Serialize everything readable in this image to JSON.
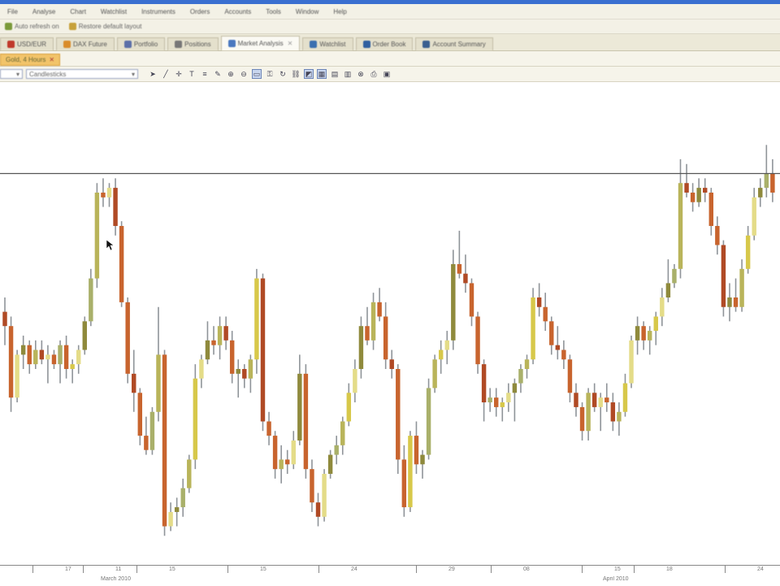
{
  "menu": [
    "File",
    "Analyse",
    "Chart",
    "Watchlist",
    "Instruments",
    "Orders",
    "Accounts",
    "Tools",
    "Window",
    "Help"
  ],
  "toolbar1": [
    {
      "label": "Auto refresh on",
      "icon": "refresh-icon",
      "color": "#7a9a3a"
    },
    {
      "label": "Restore default layout",
      "icon": "layout-icon",
      "color": "#c7a13a"
    }
  ],
  "tabs": [
    {
      "label": "USD/EUR",
      "icon": "chart-icon",
      "color": "#c0392b",
      "active": false
    },
    {
      "label": "DAX Future",
      "icon": "chart-icon",
      "color": "#d98c2b",
      "active": false
    },
    {
      "label": "Portfolio",
      "icon": "portfolio-icon",
      "color": "#5b6fa8",
      "active": false
    },
    {
      "label": "Positions",
      "icon": "positions-icon",
      "color": "#777777",
      "active": false
    },
    {
      "label": "Market Analysis",
      "icon": "analysis-icon",
      "color": "#4a78c0",
      "active": true
    },
    {
      "label": "Watchlist",
      "icon": "watchlist-icon",
      "color": "#3a6fb0",
      "active": false
    },
    {
      "label": "Order Book",
      "icon": "orderbook-icon",
      "color": "#2f5fa0",
      "active": false
    },
    {
      "label": "Account Summary",
      "icon": "account-icon",
      "color": "#3a5f90",
      "active": false
    }
  ],
  "doc_tab": {
    "label": "Gold, 4 Hours"
  },
  "chart_toolbar": {
    "interval_value": "",
    "chart_type_value": "Candlesticks"
  },
  "chart_data": {
    "type": "candlestick",
    "axis_position": "bottom",
    "reference_line": {
      "y": 1090
    },
    "ylim": [
      1012,
      1101
    ],
    "x_ticks": [
      "17",
      "11",
      "15",
      "15",
      "24",
      "29",
      "08",
      "15",
      "18",
      "24"
    ],
    "month_labels": [
      "March 2010",
      "April 2010"
    ],
    "candles": [
      {
        "o": 1061,
        "h": 1064,
        "l": 1054,
        "c": 1058
      },
      {
        "o": 1058,
        "h": 1060,
        "l": 1040,
        "c": 1043
      },
      {
        "o": 1043,
        "h": 1053,
        "l": 1042,
        "c": 1052
      },
      {
        "o": 1052,
        "h": 1056,
        "l": 1049,
        "c": 1054
      },
      {
        "o": 1054,
        "h": 1055,
        "l": 1048,
        "c": 1050
      },
      {
        "o": 1050,
        "h": 1055,
        "l": 1049,
        "c": 1053
      },
      {
        "o": 1053,
        "h": 1055,
        "l": 1050,
        "c": 1051
      },
      {
        "o": 1051,
        "h": 1054,
        "l": 1046,
        "c": 1052
      },
      {
        "o": 1052,
        "h": 1053,
        "l": 1049,
        "c": 1050
      },
      {
        "o": 1050,
        "h": 1055,
        "l": 1046,
        "c": 1054
      },
      {
        "o": 1054,
        "h": 1056,
        "l": 1047,
        "c": 1049
      },
      {
        "o": 1049,
        "h": 1051,
        "l": 1046,
        "c": 1050
      },
      {
        "o": 1050,
        "h": 1054,
        "l": 1048,
        "c": 1053
      },
      {
        "o": 1053,
        "h": 1060,
        "l": 1052,
        "c": 1059
      },
      {
        "o": 1059,
        "h": 1070,
        "l": 1058,
        "c": 1068
      },
      {
        "o": 1068,
        "h": 1088,
        "l": 1066,
        "c": 1086
      },
      {
        "o": 1086,
        "h": 1089,
        "l": 1083,
        "c": 1085
      },
      {
        "o": 1085,
        "h": 1088,
        "l": 1083,
        "c": 1087
      },
      {
        "o": 1087,
        "h": 1089,
        "l": 1077,
        "c": 1079
      },
      {
        "o": 1079,
        "h": 1080,
        "l": 1062,
        "c": 1063
      },
      {
        "o": 1063,
        "h": 1064,
        "l": 1046,
        "c": 1048
      },
      {
        "o": 1048,
        "h": 1053,
        "l": 1040,
        "c": 1044
      },
      {
        "o": 1044,
        "h": 1045,
        "l": 1033,
        "c": 1035
      },
      {
        "o": 1035,
        "h": 1039,
        "l": 1031,
        "c": 1032
      },
      {
        "o": 1032,
        "h": 1041,
        "l": 1031,
        "c": 1040
      },
      {
        "o": 1040,
        "h": 1062,
        "l": 1038,
        "c": 1052
      },
      {
        "o": 1052,
        "h": 1053,
        "l": 1014,
        "c": 1016
      },
      {
        "o": 1016,
        "h": 1021,
        "l": 1015,
        "c": 1019
      },
      {
        "o": 1019,
        "h": 1022,
        "l": 1016,
        "c": 1020
      },
      {
        "o": 1020,
        "h": 1026,
        "l": 1018,
        "c": 1024
      },
      {
        "o": 1024,
        "h": 1031,
        "l": 1023,
        "c": 1030
      },
      {
        "o": 1030,
        "h": 1050,
        "l": 1028,
        "c": 1047
      },
      {
        "o": 1047,
        "h": 1052,
        "l": 1045,
        "c": 1051
      },
      {
        "o": 1051,
        "h": 1059,
        "l": 1050,
        "c": 1055
      },
      {
        "o": 1055,
        "h": 1058,
        "l": 1052,
        "c": 1054
      },
      {
        "o": 1054,
        "h": 1060,
        "l": 1051,
        "c": 1058
      },
      {
        "o": 1058,
        "h": 1060,
        "l": 1053,
        "c": 1055
      },
      {
        "o": 1055,
        "h": 1057,
        "l": 1046,
        "c": 1048
      },
      {
        "o": 1048,
        "h": 1051,
        "l": 1043,
        "c": 1049
      },
      {
        "o": 1049,
        "h": 1050,
        "l": 1045,
        "c": 1047
      },
      {
        "o": 1047,
        "h": 1052,
        "l": 1044,
        "c": 1051
      },
      {
        "o": 1051,
        "h": 1070,
        "l": 1048,
        "c": 1068
      },
      {
        "o": 1068,
        "h": 1069,
        "l": 1036,
        "c": 1038
      },
      {
        "o": 1038,
        "h": 1040,
        "l": 1033,
        "c": 1035
      },
      {
        "o": 1035,
        "h": 1036,
        "l": 1026,
        "c": 1028
      },
      {
        "o": 1028,
        "h": 1033,
        "l": 1025,
        "c": 1030
      },
      {
        "o": 1030,
        "h": 1032,
        "l": 1027,
        "c": 1029
      },
      {
        "o": 1029,
        "h": 1036,
        "l": 1028,
        "c": 1034
      },
      {
        "o": 1034,
        "h": 1052,
        "l": 1033,
        "c": 1048
      },
      {
        "o": 1048,
        "h": 1050,
        "l": 1026,
        "c": 1028
      },
      {
        "o": 1028,
        "h": 1030,
        "l": 1019,
        "c": 1021
      },
      {
        "o": 1021,
        "h": 1023,
        "l": 1016,
        "c": 1018
      },
      {
        "o": 1018,
        "h": 1028,
        "l": 1017,
        "c": 1027
      },
      {
        "o": 1027,
        "h": 1032,
        "l": 1026,
        "c": 1031
      },
      {
        "o": 1031,
        "h": 1035,
        "l": 1029,
        "c": 1033
      },
      {
        "o": 1033,
        "h": 1039,
        "l": 1031,
        "c": 1038
      },
      {
        "o": 1038,
        "h": 1046,
        "l": 1037,
        "c": 1044
      },
      {
        "o": 1044,
        "h": 1051,
        "l": 1042,
        "c": 1049
      },
      {
        "o": 1049,
        "h": 1060,
        "l": 1047,
        "c": 1058
      },
      {
        "o": 1058,
        "h": 1062,
        "l": 1054,
        "c": 1055
      },
      {
        "o": 1055,
        "h": 1065,
        "l": 1053,
        "c": 1063
      },
      {
        "o": 1063,
        "h": 1066,
        "l": 1059,
        "c": 1060
      },
      {
        "o": 1060,
        "h": 1063,
        "l": 1049,
        "c": 1051
      },
      {
        "o": 1051,
        "h": 1053,
        "l": 1047,
        "c": 1049
      },
      {
        "o": 1049,
        "h": 1050,
        "l": 1027,
        "c": 1030
      },
      {
        "o": 1030,
        "h": 1033,
        "l": 1018,
        "c": 1020
      },
      {
        "o": 1020,
        "h": 1036,
        "l": 1019,
        "c": 1035
      },
      {
        "o": 1035,
        "h": 1038,
        "l": 1027,
        "c": 1029
      },
      {
        "o": 1029,
        "h": 1032,
        "l": 1026,
        "c": 1031
      },
      {
        "o": 1031,
        "h": 1047,
        "l": 1030,
        "c": 1045
      },
      {
        "o": 1045,
        "h": 1052,
        "l": 1044,
        "c": 1051
      },
      {
        "o": 1051,
        "h": 1055,
        "l": 1048,
        "c": 1053
      },
      {
        "o": 1053,
        "h": 1057,
        "l": 1050,
        "c": 1055
      },
      {
        "o": 1055,
        "h": 1074,
        "l": 1053,
        "c": 1071
      },
      {
        "o": 1071,
        "h": 1078,
        "l": 1068,
        "c": 1069
      },
      {
        "o": 1069,
        "h": 1073,
        "l": 1065,
        "c": 1067
      },
      {
        "o": 1067,
        "h": 1068,
        "l": 1058,
        "c": 1060
      },
      {
        "o": 1060,
        "h": 1061,
        "l": 1048,
        "c": 1050
      },
      {
        "o": 1050,
        "h": 1051,
        "l": 1038,
        "c": 1042
      },
      {
        "o": 1042,
        "h": 1045,
        "l": 1040,
        "c": 1043
      },
      {
        "o": 1043,
        "h": 1045,
        "l": 1039,
        "c": 1041
      },
      {
        "o": 1041,
        "h": 1043,
        "l": 1038,
        "c": 1042
      },
      {
        "o": 1042,
        "h": 1046,
        "l": 1040,
        "c": 1044
      },
      {
        "o": 1044,
        "h": 1047,
        "l": 1038,
        "c": 1046
      },
      {
        "o": 1046,
        "h": 1050,
        "l": 1044,
        "c": 1049
      },
      {
        "o": 1049,
        "h": 1052,
        "l": 1047,
        "c": 1051
      },
      {
        "o": 1051,
        "h": 1066,
        "l": 1050,
        "c": 1064
      },
      {
        "o": 1064,
        "h": 1067,
        "l": 1060,
        "c": 1062
      },
      {
        "o": 1062,
        "h": 1065,
        "l": 1057,
        "c": 1059
      },
      {
        "o": 1059,
        "h": 1060,
        "l": 1052,
        "c": 1054
      },
      {
        "o": 1054,
        "h": 1058,
        "l": 1051,
        "c": 1053
      },
      {
        "o": 1053,
        "h": 1055,
        "l": 1049,
        "c": 1051
      },
      {
        "o": 1051,
        "h": 1052,
        "l": 1042,
        "c": 1044
      },
      {
        "o": 1044,
        "h": 1046,
        "l": 1039,
        "c": 1041
      },
      {
        "o": 1041,
        "h": 1042,
        "l": 1034,
        "c": 1036
      },
      {
        "o": 1036,
        "h": 1045,
        "l": 1034,
        "c": 1044
      },
      {
        "o": 1044,
        "h": 1046,
        "l": 1040,
        "c": 1041
      },
      {
        "o": 1041,
        "h": 1044,
        "l": 1036,
        "c": 1043
      },
      {
        "o": 1043,
        "h": 1046,
        "l": 1040,
        "c": 1042
      },
      {
        "o": 1042,
        "h": 1044,
        "l": 1036,
        "c": 1038
      },
      {
        "o": 1038,
        "h": 1042,
        "l": 1035,
        "c": 1040
      },
      {
        "o": 1040,
        "h": 1048,
        "l": 1039,
        "c": 1046
      },
      {
        "o": 1046,
        "h": 1056,
        "l": 1045,
        "c": 1055
      },
      {
        "o": 1055,
        "h": 1060,
        "l": 1052,
        "c": 1058
      },
      {
        "o": 1058,
        "h": 1059,
        "l": 1053,
        "c": 1055
      },
      {
        "o": 1055,
        "h": 1058,
        "l": 1052,
        "c": 1057
      },
      {
        "o": 1057,
        "h": 1061,
        "l": 1054,
        "c": 1060
      },
      {
        "o": 1060,
        "h": 1066,
        "l": 1058,
        "c": 1064
      },
      {
        "o": 1064,
        "h": 1072,
        "l": 1063,
        "c": 1067
      },
      {
        "o": 1067,
        "h": 1071,
        "l": 1066,
        "c": 1070
      },
      {
        "o": 1070,
        "h": 1093,
        "l": 1068,
        "c": 1088
      },
      {
        "o": 1088,
        "h": 1092,
        "l": 1085,
        "c": 1086
      },
      {
        "o": 1086,
        "h": 1088,
        "l": 1082,
        "c": 1084
      },
      {
        "o": 1084,
        "h": 1089,
        "l": 1083,
        "c": 1087
      },
      {
        "o": 1087,
        "h": 1089,
        "l": 1084,
        "c": 1086
      },
      {
        "o": 1086,
        "h": 1087,
        "l": 1077,
        "c": 1079
      },
      {
        "o": 1079,
        "h": 1081,
        "l": 1073,
        "c": 1075
      },
      {
        "o": 1075,
        "h": 1076,
        "l": 1060,
        "c": 1062
      },
      {
        "o": 1062,
        "h": 1067,
        "l": 1059,
        "c": 1064
      },
      {
        "o": 1064,
        "h": 1068,
        "l": 1061,
        "c": 1062
      },
      {
        "o": 1062,
        "h": 1072,
        "l": 1061,
        "c": 1070
      },
      {
        "o": 1070,
        "h": 1079,
        "l": 1069,
        "c": 1077
      },
      {
        "o": 1077,
        "h": 1087,
        "l": 1076,
        "c": 1085
      },
      {
        "o": 1085,
        "h": 1089,
        "l": 1083,
        "c": 1087
      },
      {
        "o": 1087,
        "h": 1096,
        "l": 1085,
        "c": 1090
      },
      {
        "o": 1090,
        "h": 1093,
        "l": 1084,
        "c": 1086
      }
    ]
  }
}
